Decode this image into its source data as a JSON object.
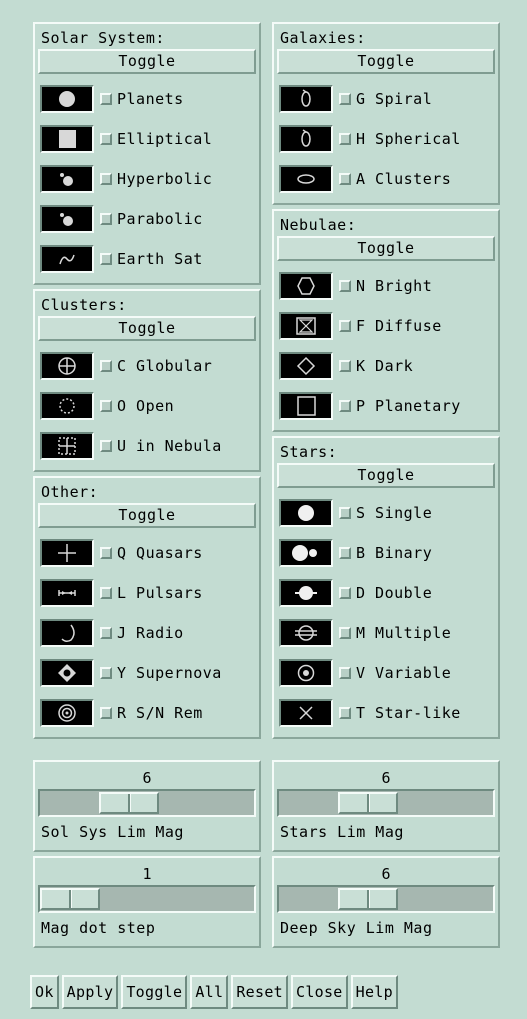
{
  "toggle_label": "Toggle",
  "solar": {
    "title": "Solar System:",
    "items": [
      {
        "label": "Planets",
        "icon": "planet-disc-icon"
      },
      {
        "label": "Elliptical",
        "icon": "elliptical-orbit-square-icon"
      },
      {
        "label": "Hyperbolic",
        "icon": "hyperbolic-orbit-icon"
      },
      {
        "label": "Parabolic",
        "icon": "parabolic-orbit-icon"
      },
      {
        "label": "Earth Sat",
        "icon": "earth-satellite-icon"
      }
    ]
  },
  "clusters": {
    "title": "Clusters:",
    "items": [
      {
        "label": "C Globular",
        "icon": "globular-cluster-icon"
      },
      {
        "label": "O Open",
        "icon": "open-cluster-icon"
      },
      {
        "label": "U in Nebula",
        "icon": "cluster-in-nebula-icon"
      }
    ]
  },
  "other": {
    "title": "Other:",
    "items": [
      {
        "label": "Q Quasars",
        "icon": "quasar-cross-icon"
      },
      {
        "label": "L Pulsars",
        "icon": "pulsar-icon"
      },
      {
        "label": "J Radio",
        "icon": "radio-source-icon"
      },
      {
        "label": "Y Supernova",
        "icon": "supernova-icon"
      },
      {
        "label": "R S/N Rem",
        "icon": "supernova-remnant-icon"
      }
    ]
  },
  "galaxies": {
    "title": "Galaxies:",
    "items": [
      {
        "label": "G Spiral",
        "icon": "spiral-galaxy-icon"
      },
      {
        "label": "H Spherical",
        "icon": "spherical-galaxy-icon"
      },
      {
        "label": "A Clusters",
        "icon": "galaxy-cluster-icon"
      }
    ]
  },
  "nebulae": {
    "title": "Nebulae:",
    "items": [
      {
        "label": "N Bright",
        "icon": "bright-nebula-icon"
      },
      {
        "label": "F Diffuse",
        "icon": "diffuse-nebula-icon"
      },
      {
        "label": "K Dark",
        "icon": "dark-nebula-icon"
      },
      {
        "label": "P Planetary",
        "icon": "planetary-nebula-icon"
      }
    ]
  },
  "stars": {
    "title": "Stars:",
    "items": [
      {
        "label": "S Single",
        "icon": "single-star-icon"
      },
      {
        "label": "B Binary",
        "icon": "binary-star-icon"
      },
      {
        "label": "D Double",
        "icon": "double-star-icon"
      },
      {
        "label": "M Multiple",
        "icon": "multiple-star-icon"
      },
      {
        "label": "V Variable",
        "icon": "variable-star-icon"
      },
      {
        "label": "T Star-like",
        "icon": "star-like-icon"
      }
    ]
  },
  "sliders": {
    "sol_sys": {
      "value": "6",
      "label": "Sol Sys Lim Mag",
      "fraction": 0.38
    },
    "stars": {
      "value": "6",
      "label": "Stars Lim Mag",
      "fraction": 0.38
    },
    "mag_dot": {
      "value": "1",
      "label": "Mag dot step",
      "fraction": 0.0
    },
    "deep_sky": {
      "value": "6",
      "label": "Deep Sky Lim Mag",
      "fraction": 0.38
    }
  },
  "buttons": {
    "ok": "Ok",
    "apply": "Apply",
    "toggle": "Toggle",
    "all": "All",
    "reset": "Reset",
    "close": "Close",
    "help": "Help"
  },
  "colors": {
    "background": "#c3dcd2",
    "swatch": "#000000"
  }
}
